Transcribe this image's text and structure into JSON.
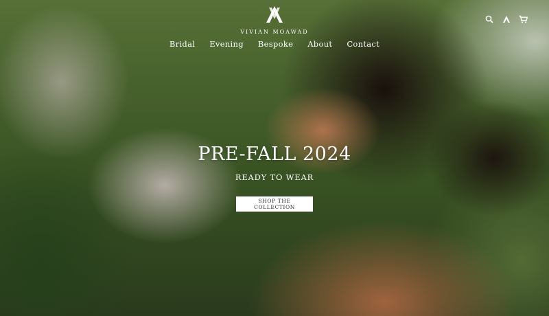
{
  "header": {
    "brand_name": "VIVIAN MOAWAD",
    "nav": [
      {
        "label": "Bridal"
      },
      {
        "label": "Evening"
      },
      {
        "label": "Bespoke"
      },
      {
        "label": "About"
      },
      {
        "label": "Contact"
      }
    ],
    "icons": [
      "search-icon",
      "account-icon",
      "cart-icon"
    ]
  },
  "hero": {
    "title": "PRE-FALL 2024",
    "subtitle": "READY TO WEAR",
    "cta_label": "SHOP THE COLLECTION"
  }
}
